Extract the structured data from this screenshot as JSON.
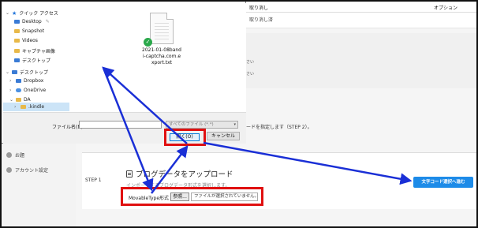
{
  "background_page": {
    "top_cancel_label": "取り消し",
    "top_option_label": "オプション",
    "top_cancel2_label": "取り消し済",
    "mid_text1": "さい",
    "mid_text2": "さい",
    "step2_text": "ードを指定します（STEP 2）。",
    "sidebar": {
      "help": "お題",
      "account": "アカウント設定"
    },
    "step1_label": "STEP 1",
    "section_title": "ブログデータをアップロード",
    "section_subtitle": "インポートするブログデータ形式を選択します。",
    "format_select": "MovableType形式",
    "browse_button": "参照...",
    "file_status": "ファイルが選択されていません。",
    "encoding_button": "文字コード選択へ進む"
  },
  "file_dialog": {
    "nav_items": [
      {
        "label": "クイック アクセス",
        "icon": "star-icon"
      },
      {
        "label": "Desktop",
        "icon": "folder-icon"
      },
      {
        "label": "Snapshot",
        "icon": "folder-icon"
      },
      {
        "label": "Videos",
        "icon": "folder-icon"
      },
      {
        "label": "キャプチャ画像",
        "icon": "folder-icon"
      },
      {
        "label": "デスクトップ",
        "icon": "folder-icon"
      },
      {
        "label": "デスクトップ",
        "icon": "desktop-icon"
      },
      {
        "label": "Dropbox",
        "icon": "dropbox-icon"
      },
      {
        "label": "OneDrive",
        "icon": "cloud-icon"
      },
      {
        "label": "DA",
        "icon": "folder-icon"
      },
      {
        "label": ".kindle",
        "icon": "folder-icon"
      }
    ],
    "file": {
      "name": "2021-01-08bandi-captcha.com.export.txt"
    },
    "filename_label": "ファイル名(N):",
    "filename_value": "",
    "filetype_value": "すべてのファイル (*.*)",
    "open_button": "開く(O)",
    "cancel_button": "キャンセル"
  },
  "colors": {
    "highlight_red": "#e01010",
    "arrow_blue": "#1a2fd6",
    "primary_button": "#1d8be8"
  }
}
